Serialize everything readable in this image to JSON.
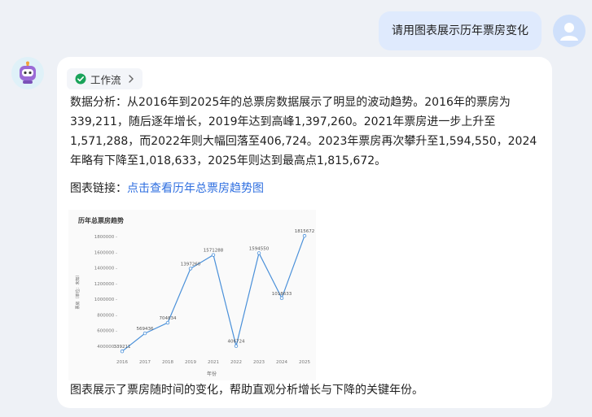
{
  "user_message": {
    "text": "请用图表展示历年票房变化"
  },
  "assistant": {
    "workflow_chip": {
      "label": "工作流"
    },
    "analysis": "数据分析：从2016年到2025年的总票房数据展示了明显的波动趋势。2016年的票房为339,211，随后逐年增长，2019年达到高峰1,397,260。2021年票房进一步上升至1,571,288，而2022年则大幅回落至406,724。2023年票房再次攀升至1,594,550，2024年略有下降至1,018,633，2025年则达到最高点1,815,672。",
    "chart_link_prefix": "图表链接：",
    "chart_link_text": "点击查看历年总票房趋势图",
    "conclusion": "图表展示了票房随时间的变化，帮助直观分析增长与下降的关键年份。"
  },
  "colors": {
    "accent": "#2f6fe0",
    "line": "#4a90d9",
    "user_bubble": "#dfeafd",
    "success": "#1aa35a"
  },
  "chart_data": {
    "type": "line",
    "title": "历年总票房趋势",
    "xlabel": "年份",
    "ylabel": "票房（单位：未知）",
    "x": [
      "2016",
      "2017",
      "2018",
      "2019",
      "2021",
      "2022",
      "2023",
      "2024",
      "2025"
    ],
    "values": [
      339211,
      569436,
      704834,
      1397260,
      1571288,
      406724,
      1594550,
      1018633,
      1815672
    ],
    "data_labels": [
      "339211",
      "569436",
      "704834",
      "1397260",
      "1571288",
      "406724",
      "1594550",
      "1018633",
      "1815672"
    ],
    "yticks": [
      400000,
      600000,
      800000,
      1000000,
      1200000,
      1400000,
      1600000,
      1800000
    ],
    "ylim": [
      300000,
      1900000
    ],
    "grid": false,
    "legend": "none"
  }
}
